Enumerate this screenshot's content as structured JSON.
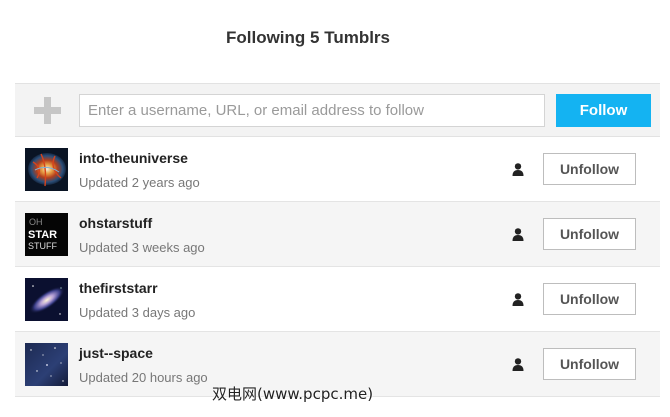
{
  "header": {
    "title": "Following 5 Tumblrs"
  },
  "follow_bar": {
    "placeholder": "Enter a username, URL, or email address to follow",
    "value": "",
    "button_label": "Follow",
    "plus_icon": "plus-icon"
  },
  "rows": [
    {
      "name": "into-theuniverse",
      "updated": "Updated 2 years ago",
      "avatar": "crab-nebula-avatar",
      "unfollow_label": "Unfollow"
    },
    {
      "name": "ohstarstuff",
      "updated": "Updated 3 weeks ago",
      "avatar": "oh-star-stuff-avatar",
      "avatar_text": [
        "OH",
        "STAR",
        "STUFF"
      ],
      "unfollow_label": "Unfollow"
    },
    {
      "name": "thefirststarr",
      "updated": "Updated 3 days ago",
      "avatar": "galaxy-avatar",
      "unfollow_label": "Unfollow"
    },
    {
      "name": "just--space",
      "updated": "Updated 20 hours ago",
      "avatar": "starfield-avatar",
      "unfollow_label": "Unfollow"
    }
  ],
  "watermark": "双电网(www.pcpc.me)",
  "colors": {
    "follow_button": "#14b3f2",
    "bar_background": "#f3f3f3",
    "alt_row": "#f5f5f5"
  }
}
